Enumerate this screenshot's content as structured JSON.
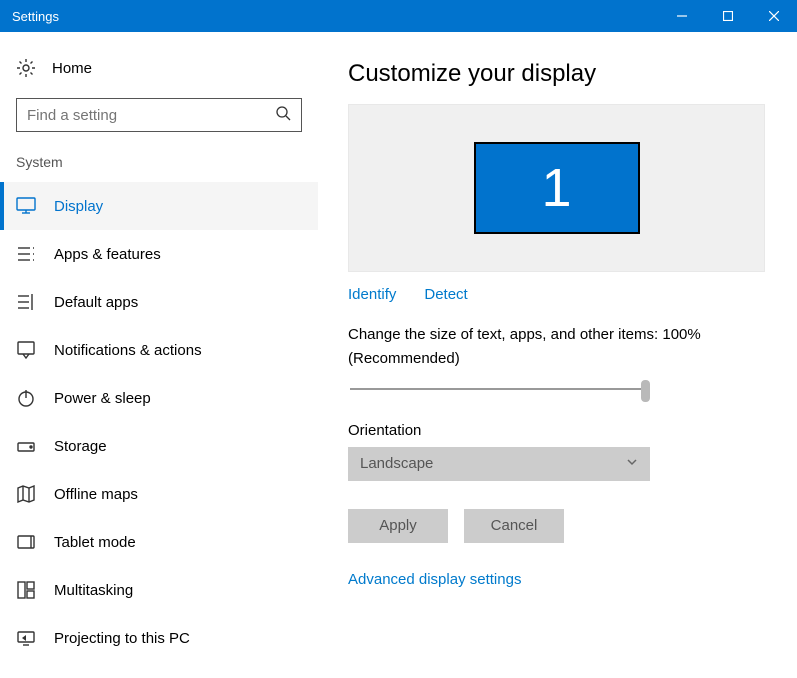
{
  "window": {
    "title": "Settings"
  },
  "sidebar": {
    "home_label": "Home",
    "search_placeholder": "Find a setting",
    "section_label": "System",
    "items": [
      {
        "label": "Display"
      },
      {
        "label": "Apps & features"
      },
      {
        "label": "Default apps"
      },
      {
        "label": "Notifications & actions"
      },
      {
        "label": "Power & sleep"
      },
      {
        "label": "Storage"
      },
      {
        "label": "Offline maps"
      },
      {
        "label": "Tablet mode"
      },
      {
        "label": "Multitasking"
      },
      {
        "label": "Projecting to this PC"
      }
    ]
  },
  "main": {
    "heading": "Customize your display",
    "monitor_number": "1",
    "identify_label": "Identify",
    "detect_label": "Detect",
    "scale_text_1": "Change the size of text, apps, and other items: 100%",
    "scale_text_2": "(Recommended)",
    "orientation_label": "Orientation",
    "orientation_value": "Landscape",
    "apply_label": "Apply",
    "cancel_label": "Cancel",
    "advanced_label": "Advanced display settings"
  }
}
